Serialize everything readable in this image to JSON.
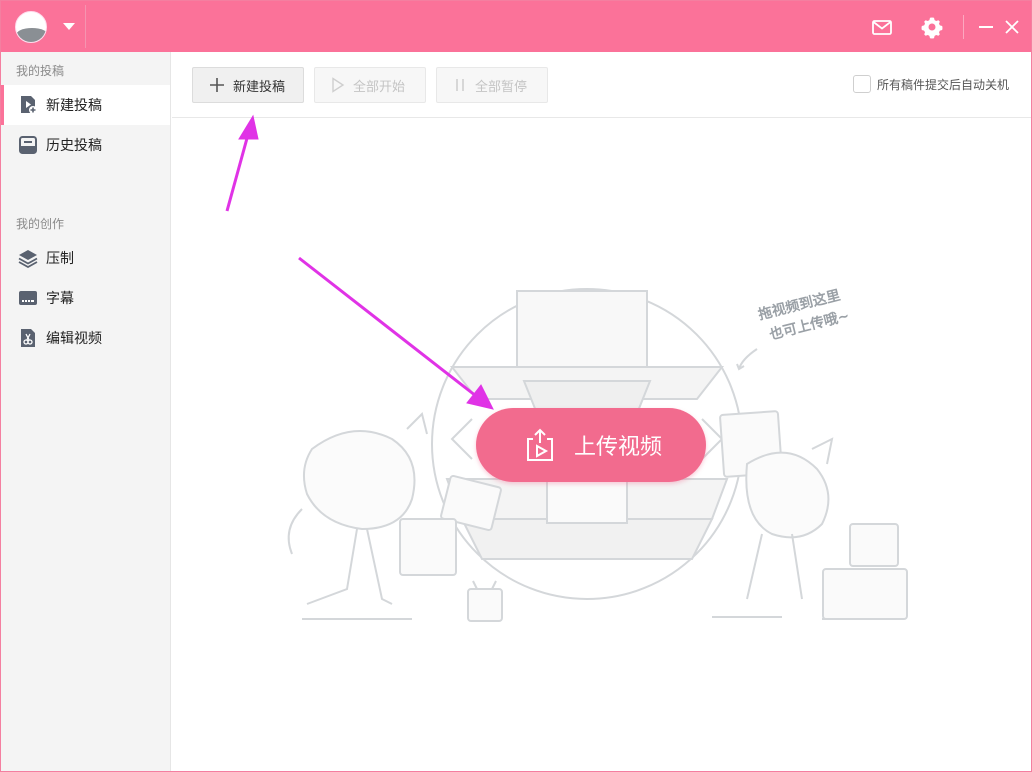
{
  "titlebar": {
    "mail_icon": "mail-icon",
    "settings_icon": "gear-icon",
    "minimize_icon": "minimize-icon",
    "close_icon": "close-icon",
    "accent": "#fb7299"
  },
  "sidebar": {
    "sections": [
      {
        "label": "我的投稿",
        "items": [
          {
            "label": "新建投稿",
            "icon": "new-upload-icon",
            "active": true
          },
          {
            "label": "历史投稿",
            "icon": "history-icon",
            "active": false
          }
        ]
      },
      {
        "label": "我的创作",
        "items": [
          {
            "label": "压制",
            "icon": "layers-icon",
            "active": false
          },
          {
            "label": "字幕",
            "icon": "subtitle-icon",
            "active": false
          },
          {
            "label": "编辑视频",
            "icon": "scissors-icon",
            "active": false
          }
        ]
      }
    ]
  },
  "toolbar": {
    "new_label": "新建投稿",
    "start_all_label": "全部开始",
    "pause_all_label": "全部暂停",
    "auto_shutdown_label": "所有稿件提交后自动关机",
    "auto_shutdown_checked": false
  },
  "main": {
    "upload_label": "上传视频",
    "drag_hint_line1": "拖视频到这里",
    "drag_hint_line2": "也可上传哦~",
    "upload_color": "#f26b8e"
  },
  "annotations": {
    "arrow_color": "#e033e6"
  }
}
